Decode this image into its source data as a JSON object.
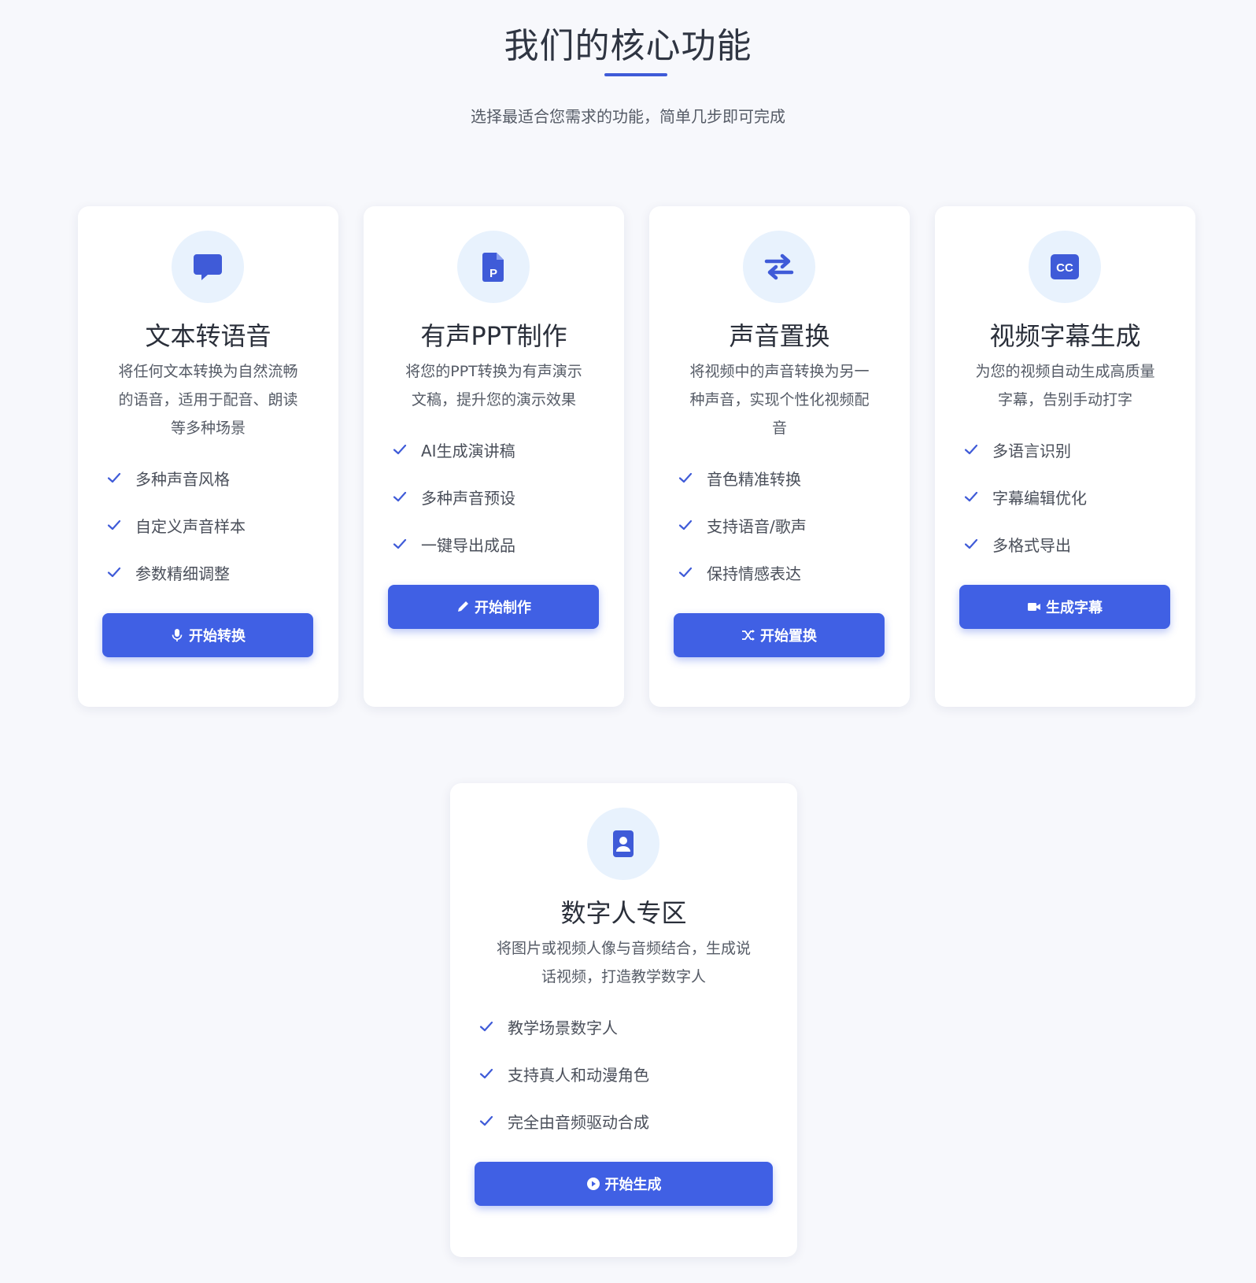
{
  "section": {
    "title": "我们的核心功能",
    "subtitle": "选择最适合您需求的功能，简单几步即可完成"
  },
  "colors": {
    "accent": "#4060e4",
    "icon_bg": "#e8f2fd",
    "page_bg": "#f7f8fc"
  },
  "cards": [
    {
      "icon": "speech-bubble-icon",
      "title": "文本转语音",
      "desc": [
        "将任何文本转换为自然流畅",
        "的语音，适用于配音、朗读",
        "等多种场景"
      ],
      "features": [
        "多种声音风格",
        "自定义声音样本",
        "参数精细调整"
      ],
      "button_icon": "microphone-icon",
      "button_label": "开始转换"
    },
    {
      "icon": "ppt-file-icon",
      "title": "有声PPT制作",
      "desc": [
        "将您的PPT转换为有声演示",
        "文稿，提升您的演示效果"
      ],
      "features": [
        "AI生成演讲稿",
        "多种声音预设",
        "一键导出成品"
      ],
      "button_icon": "pencil-icon",
      "button_label": "开始制作"
    },
    {
      "icon": "swap-arrows-icon",
      "title": "声音置换",
      "desc": [
        "将视频中的声音转换为另一",
        "种声音，实现个性化视频配",
        "音"
      ],
      "features": [
        "音色精准转换",
        "支持语音/歌声",
        "保持情感表达"
      ],
      "button_icon": "shuffle-icon",
      "button_label": "开始置换"
    },
    {
      "icon": "closed-caption-icon",
      "title": "视频字幕生成",
      "desc": [
        "为您的视频自动生成高质量",
        "字幕，告别手动打字"
      ],
      "features": [
        "多语言识别",
        "字幕编辑优化",
        "多格式导出"
      ],
      "button_icon": "video-camera-icon",
      "button_label": "生成字幕"
    },
    {
      "icon": "id-badge-icon",
      "title": "数字人专区",
      "desc": [
        "将图片或视频人像与音频结合，生成说",
        "话视频，打造教学数字人"
      ],
      "features": [
        "教学场景数字人",
        "支持真人和动漫角色",
        "完全由音频驱动合成"
      ],
      "button_icon": "play-circle-icon",
      "button_label": "开始生成"
    }
  ]
}
